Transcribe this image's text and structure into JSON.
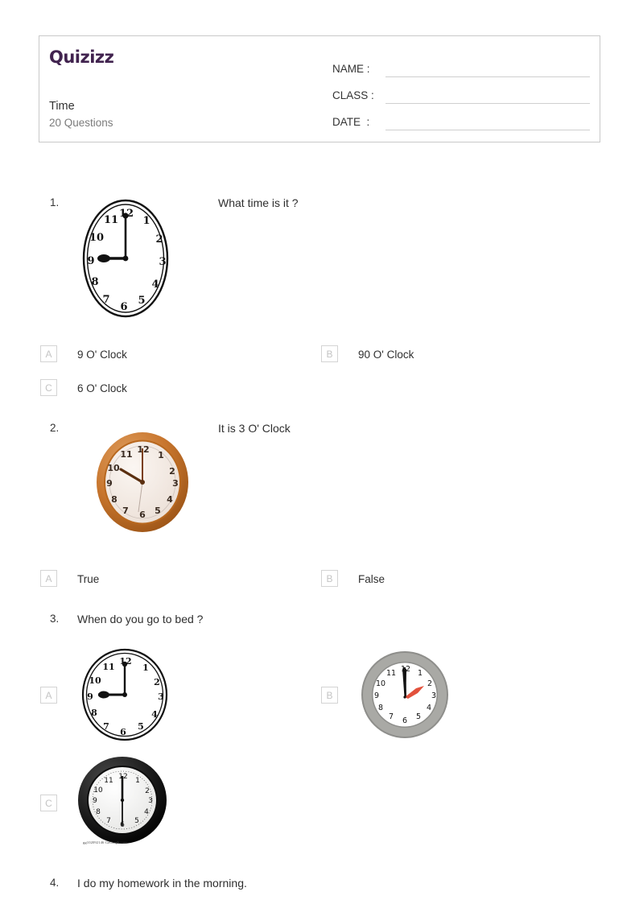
{
  "header": {
    "logo_text": "Quizizz",
    "logo_color": "#41234f",
    "title": "Time",
    "subtitle": "20 Questions",
    "fields": [
      {
        "label": "NAME :",
        "value": ""
      },
      {
        "label": "CLASS :",
        "value": ""
      },
      {
        "label": "DATE  :",
        "value": ""
      }
    ]
  },
  "questions": [
    {
      "number": "1.",
      "text": "What time is it ?",
      "image": {
        "name": "clock-sketch-9-oclock",
        "style": "sketch",
        "hour": 9,
        "minute": 0
      },
      "options": [
        {
          "letter": "A",
          "text": "9 O' Clock"
        },
        {
          "letter": "B",
          "text": "90 O' Clock"
        },
        {
          "letter": "C",
          "text": "6 O' Clock"
        }
      ]
    },
    {
      "number": "2.",
      "text": "It is 3 O' Clock",
      "image": {
        "name": "clock-orange-10-oclock",
        "style": "orange",
        "hour": 10,
        "minute": 0
      },
      "options": [
        {
          "letter": "A",
          "text": "True"
        },
        {
          "letter": "B",
          "text": "False"
        }
      ]
    },
    {
      "number": "3.",
      "text": "When do you go to bed ?",
      "options": [
        {
          "letter": "A",
          "image": {
            "name": "clock-sketch-9-oclock",
            "style": "sketch",
            "hour": 9,
            "minute": 0
          }
        },
        {
          "letter": "B",
          "image": {
            "name": "clock-gray-12-oclock",
            "style": "gray",
            "hour": 12,
            "minute": 0
          }
        },
        {
          "letter": "C",
          "image": {
            "name": "clock-black-6-oclock",
            "style": "black",
            "hour": 12,
            "minute": 30,
            "watermark": "gg102092146 GoGraph.com"
          }
        }
      ]
    },
    {
      "number": "4.",
      "text": "I do my homework in the morning."
    }
  ],
  "clock_numerals": [
    "12",
    "1",
    "2",
    "3",
    "4",
    "5",
    "6",
    "7",
    "8",
    "9",
    "10",
    "11"
  ],
  "colors": {
    "orange_bezel": "#c8762e",
    "orange_bezel_dark": "#a85d1d",
    "orange_face": "#f2e7df",
    "gray_bezel": "#9a9a97",
    "gray_face": "#ffffff",
    "black_bezel": "#161616",
    "black_face": "#f4f4f2",
    "second_hand_red": "#e2513c",
    "sketch_ink": "#111111",
    "box_border": "#d4d4d4"
  }
}
